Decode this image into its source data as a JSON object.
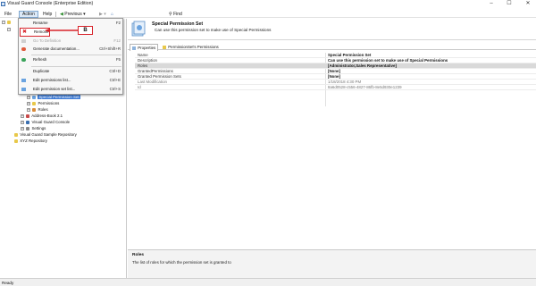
{
  "window": {
    "title": "Visual Guard Console (Enterprise Edition)"
  },
  "menubar": {
    "items": [
      "File",
      "Action",
      "Help"
    ],
    "toolbar": {
      "previous": "Previous",
      "find": "Find"
    }
  },
  "dropdown": {
    "items": [
      {
        "label": "Rename",
        "shortcut": "F2",
        "disabled": false
      },
      {
        "label": "Remove",
        "shortcut": "",
        "disabled": false
      },
      {
        "label": "Go To Definition",
        "shortcut": "F12",
        "disabled": true
      },
      {
        "label": "Generate documentation...",
        "shortcut": "Ctrl+Shift+R",
        "disabled": false
      },
      {
        "label": "Refresh",
        "shortcut": "F5",
        "disabled": false
      },
      {
        "label": "Duplicate",
        "shortcut": "Ctrl+D",
        "disabled": false
      },
      {
        "label": "Edit permissions list...",
        "shortcut": "Ctrl+E",
        "disabled": false
      },
      {
        "label": "Edit permission set list...",
        "shortcut": "Ctrl+S",
        "disabled": false
      }
    ]
  },
  "callout": {
    "label": "B"
  },
  "tree": {
    "items": [
      {
        "label": "Special Permission Set",
        "selected": true
      },
      {
        "label": "Permissions"
      },
      {
        "label": "Roles"
      },
      {
        "label": "Address-Book 2.1"
      },
      {
        "label": "Visual Guard Console"
      },
      {
        "label": "Settings"
      },
      {
        "label": "Visual Guard Sample Repository"
      },
      {
        "label": "XYZ Repository"
      }
    ]
  },
  "header": {
    "title": "Special Permission Set",
    "description": "Can use this permission set to make use of Special Permissions"
  },
  "tabs": [
    "Properties",
    "PermissionSet's Permissions"
  ],
  "properties": [
    {
      "key": "Name",
      "value": "Special Permission Set"
    },
    {
      "key": "Description",
      "value": "Can use this permission set to make use of Special Permissions"
    },
    {
      "key": "Roles",
      "value": "[Administrator,Sales Representative]"
    },
    {
      "key": "GrantedPermissions",
      "value": "[None]"
    },
    {
      "key": "Granted Permission Sets",
      "value": "[None]"
    },
    {
      "key": "Last Modification",
      "value": "1/18/2018 4:30 PM"
    },
    {
      "key": "Id",
      "value": "8a6d0528-c556-4827-86fb-8e5d930e1239"
    }
  ],
  "description_panel": {
    "title": "Roles",
    "text": "The list of roles for which the permission set is granted to"
  },
  "status": {
    "text": "Ready"
  },
  "colors": {
    "accent": "#3d7bd6",
    "callout": "#d8232a"
  }
}
